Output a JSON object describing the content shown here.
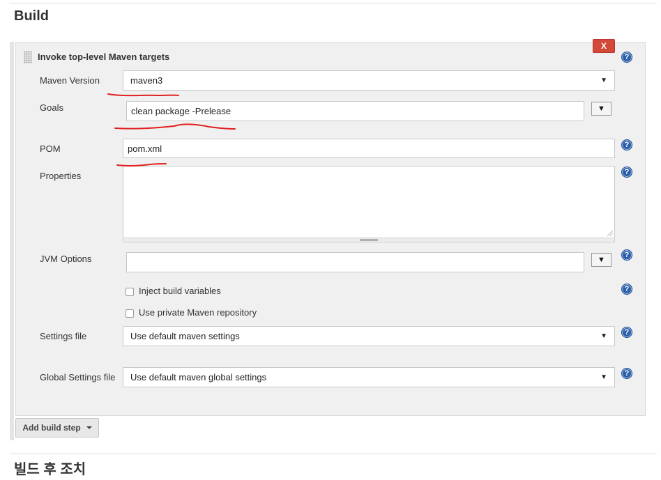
{
  "sections": {
    "build_title": "Build",
    "post_build_title": "빌드 후 조치"
  },
  "step": {
    "title": "Invoke top-level Maven targets",
    "delete_label": "X",
    "help_icon": "?"
  },
  "fields": {
    "maven_version": {
      "label": "Maven Version",
      "value": "maven3"
    },
    "goals": {
      "label": "Goals",
      "value": "clean package -Prelease"
    },
    "pom": {
      "label": "POM",
      "value": "pom.xml"
    },
    "properties": {
      "label": "Properties",
      "value": ""
    },
    "jvm_options": {
      "label": "JVM Options",
      "value": ""
    },
    "inject_build_variables": {
      "label": "Inject build variables",
      "checked": false
    },
    "private_repo": {
      "label": "Use private Maven repository",
      "checked": false
    },
    "settings_file": {
      "label": "Settings file",
      "value": "Use default maven settings"
    },
    "global_settings_file": {
      "label": "Global Settings file",
      "value": "Use default maven global settings"
    }
  },
  "add_build_step": {
    "label": "Add build step"
  },
  "colors": {
    "delete_button": "#d24939",
    "help_icon": "#2b5ea8",
    "annotation": "#e02020"
  }
}
